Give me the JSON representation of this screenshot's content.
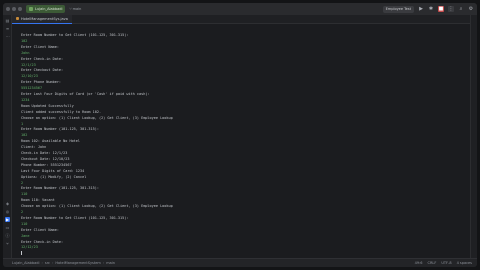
{
  "titlebar": {
    "project_name": "Lujain_Alabbadi",
    "branch": "main",
    "run_config": "Employee Test"
  },
  "tabs": [
    {
      "label": "HotelManagementSys.java"
    }
  ],
  "console_lines": [
    {
      "text": "Enter Room Number to Get Client (101-125, 301-315):",
      "kind": "out"
    },
    {
      "text": "102",
      "kind": "in"
    },
    {
      "text": "Enter Client Name:",
      "kind": "out"
    },
    {
      "text": "John",
      "kind": "in"
    },
    {
      "text": "Enter Check-in Date:",
      "kind": "out"
    },
    {
      "text": "12/1/23",
      "kind": "in"
    },
    {
      "text": "Enter Checkout Date:",
      "kind": "out"
    },
    {
      "text": "12/10/23",
      "kind": "in"
    },
    {
      "text": "Enter Phone Number:",
      "kind": "out"
    },
    {
      "text": "5551234567",
      "kind": "in"
    },
    {
      "text": "Enter Last Four Digits of Card (or 'Cash' if paid with cash):",
      "kind": "out"
    },
    {
      "text": "1234",
      "kind": "in"
    },
    {
      "text": "Room Updated Successfully",
      "kind": "out"
    },
    {
      "text": "Client added successfully to Room 102.",
      "kind": "out"
    },
    {
      "text": "Choose an option: (1) Client Lookup, (2) Get Client, (3) Employee Lookup",
      "kind": "out"
    },
    {
      "text": "1",
      "kind": "in"
    },
    {
      "text": "Enter Room Number (101-125, 301-315):",
      "kind": "out"
    },
    {
      "text": "102",
      "kind": "in"
    },
    {
      "text": "Room 102: Available No Hotel",
      "kind": "out"
    },
    {
      "text": "Client: John",
      "kind": "out"
    },
    {
      "text": "Check-in Date: 12/1/23",
      "kind": "out"
    },
    {
      "text": "Checkout Date: 12/10/23",
      "kind": "out"
    },
    {
      "text": "Phone Number: 5551234567",
      "kind": "out"
    },
    {
      "text": "Last Four Digits of Card: 1234",
      "kind": "out"
    },
    {
      "text": "Options: (1) Modify, (2) Cancel",
      "kind": "out"
    },
    {
      "text": "2",
      "kind": "in"
    },
    {
      "text": "Enter Room Number (101-125, 301-315):",
      "kind": "out"
    },
    {
      "text": "110",
      "kind": "in"
    },
    {
      "text": "Room 110: Vacant",
      "kind": "out"
    },
    {
      "text": "Choose an option: (1) Client Lookup, (2) Get Client, (3) Employee Lookup",
      "kind": "out"
    },
    {
      "text": "2",
      "kind": "in"
    },
    {
      "text": "Enter Room Number to Get Client (101-125, 301-315):",
      "kind": "out"
    },
    {
      "text": "110",
      "kind": "in"
    },
    {
      "text": "Enter Client Name:",
      "kind": "out"
    },
    {
      "text": "Jane",
      "kind": "in"
    },
    {
      "text": "Enter Check-in Date:",
      "kind": "out"
    },
    {
      "text": "12/12/23",
      "kind": "in"
    }
  ],
  "statusbar": {
    "crumbs": [
      "Lujain_Alabbadi",
      "src",
      "HotelManagementSystem",
      "main"
    ],
    "position": "49:6",
    "line_sep": "CRLF",
    "encoding": "UTF-8",
    "indent": "4 spaces"
  },
  "colors": {
    "accent": "#3574f0",
    "user_input": "#62b06a",
    "project_badge": "#3c5a36"
  },
  "icons": {
    "run": "play-icon",
    "debug": "bug-icon",
    "stop": "stop-icon",
    "search": "search-icon",
    "settings": "gear-icon"
  }
}
